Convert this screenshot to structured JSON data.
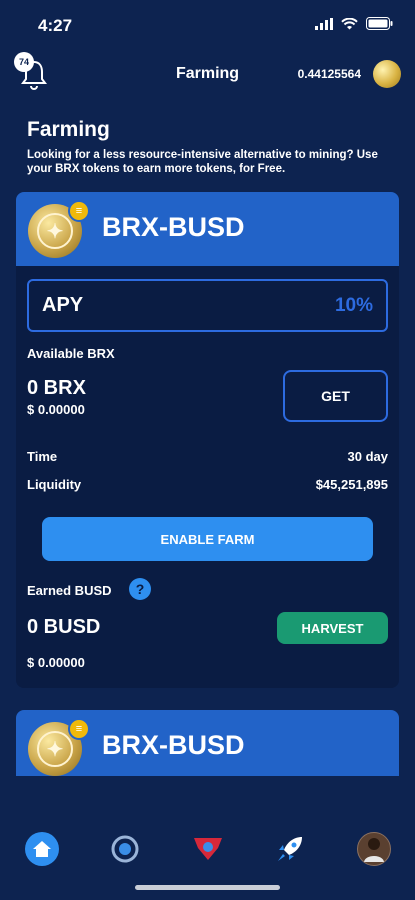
{
  "status_bar": {
    "time": "4:27"
  },
  "header": {
    "notification_count": "74",
    "title": "Farming",
    "balance": "0.44125564"
  },
  "intro": {
    "title": "Farming",
    "description": "Looking for a less resource-intensive alternative to mining? Use your BRX tokens to earn more tokens, for Free."
  },
  "farms": [
    {
      "pair": "BRX-BUSD",
      "apy_label": "APY",
      "apy_value": "10%",
      "available_label": "Available BRX",
      "available_amount": "0 BRX",
      "available_usd": "$ 0.00000",
      "get_label": "GET",
      "time_label": "Time",
      "time_value": "30 day",
      "liquidity_label": "Liquidity",
      "liquidity_value": "$45,251,895",
      "enable_label": "ENABLE FARM",
      "earned_label": "Earned BUSD",
      "help_symbol": "?",
      "earned_amount": "0 BUSD",
      "earned_usd": "$ 0.00000",
      "harvest_label": "HARVEST"
    },
    {
      "pair": "BRX-BUSD"
    }
  ],
  "bottom_nav": {
    "items": [
      "home-icon",
      "exchange-icon",
      "hero-badge-icon",
      "rocket-icon",
      "profile-avatar"
    ]
  },
  "colors": {
    "background": "#0d2350",
    "card": "#0a1c43",
    "card_header": "#2263c8",
    "accent": "#2d6be0",
    "primary_button": "#2e8ff0",
    "harvest_button": "#1a9a72"
  }
}
